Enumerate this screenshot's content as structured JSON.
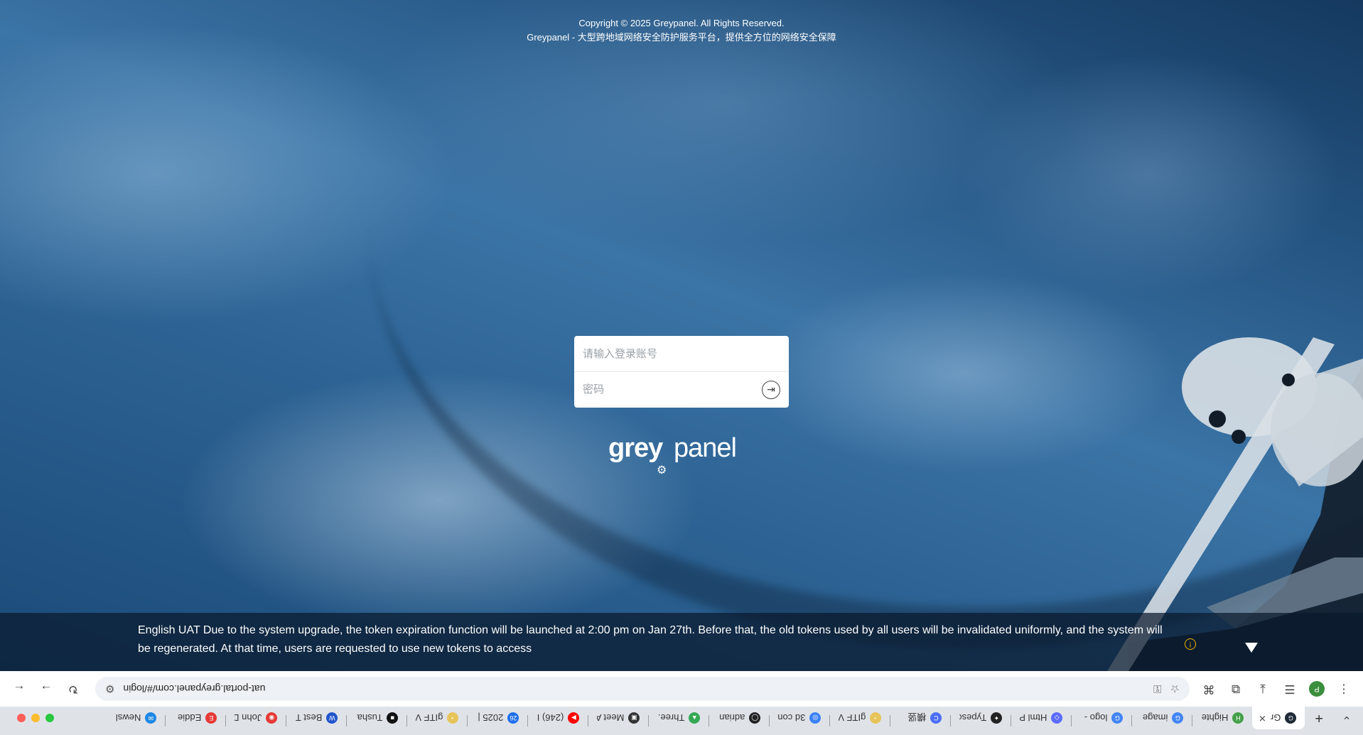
{
  "browser": {
    "tabs": [
      {
        "label": "Gr",
        "active": true,
        "fav_color": "#1f2a37",
        "fav_glyph": "G"
      },
      {
        "label": "Highte",
        "fav_color": "#43a047",
        "fav_glyph": "H"
      },
      {
        "label": "image",
        "fav_color": "#4285f4",
        "fav_glyph": "G"
      },
      {
        "label": "logo -",
        "fav_color": "#4285f4",
        "fav_glyph": "G"
      },
      {
        "label": "Html P",
        "fav_color": "#5b6cff",
        "fav_glyph": "◇"
      },
      {
        "label": "Typesc",
        "fav_color": "#222222",
        "fav_glyph": "✦"
      },
      {
        "label": "横竖",
        "fav_color": "#4c6ef5",
        "fav_glyph": "C"
      },
      {
        "label": "gITF V",
        "fav_color": "#e7c45a",
        "fav_glyph": "◔"
      },
      {
        "label": "3d con",
        "fav_color": "#3b82f6",
        "fav_glyph": "◎"
      },
      {
        "label": "adrian",
        "fav_color": "#222222",
        "fav_glyph": "◯"
      },
      {
        "label": "Three.",
        "fav_color": "#34a853",
        "fav_glyph": "▲"
      },
      {
        "label": "Meet A",
        "fav_color": "#333333",
        "fav_glyph": "▣"
      },
      {
        "label": "(246) I",
        "fav_color": "#ff0000",
        "fav_glyph": "▶"
      },
      {
        "label": "2025 |",
        "fav_color": "#1f6feb",
        "fav_glyph": "26"
      },
      {
        "label": "gITF V",
        "fav_color": "#e7c45a",
        "fav_glyph": "◔"
      },
      {
        "label": "Tusha",
        "fav_color": "#111111",
        "fav_glyph": "■"
      },
      {
        "label": "Best T",
        "fav_color": "#2255cc",
        "fav_glyph": "W"
      },
      {
        "label": "John D",
        "fav_color": "#e53935",
        "fav_glyph": "◉"
      },
      {
        "label": "Eddie",
        "fav_color": "#e53935",
        "fav_glyph": "E"
      },
      {
        "label": "Newsl",
        "fav_color": "#1e88e5",
        "fav_glyph": "✉"
      }
    ],
    "new_tab_glyph": "+",
    "url": "uat-portal.greypanel.com/#/login",
    "profile_initial": "P",
    "colors": {
      "traffic_red": "#ff5f57",
      "traffic_yellow": "#febc2e",
      "traffic_green": "#28c840"
    }
  },
  "notice": {
    "warn_glyph": "!",
    "text": "English UAT Due to the system upgrade, the token expiration function will be launched at 2:00 pm on Jan 27th. Before that, the old tokens used by all users will be invalidated uniformly, and the system will be regenerated. At that time, users are requested to use new tokens to access"
  },
  "logo": {
    "part1": "grey",
    "part2": "panel",
    "gear": "⚙"
  },
  "login": {
    "username_placeholder": "请输入登录账号",
    "password_placeholder": "密码",
    "submit_glyph": "⇥"
  },
  "footer": {
    "line1": "Greypanel - 大型跨地域网络安全防护服务平台，提供全方位的网络安全保障",
    "line2": "Copyright © 2025 Greypanel. All Rights Reserved."
  }
}
